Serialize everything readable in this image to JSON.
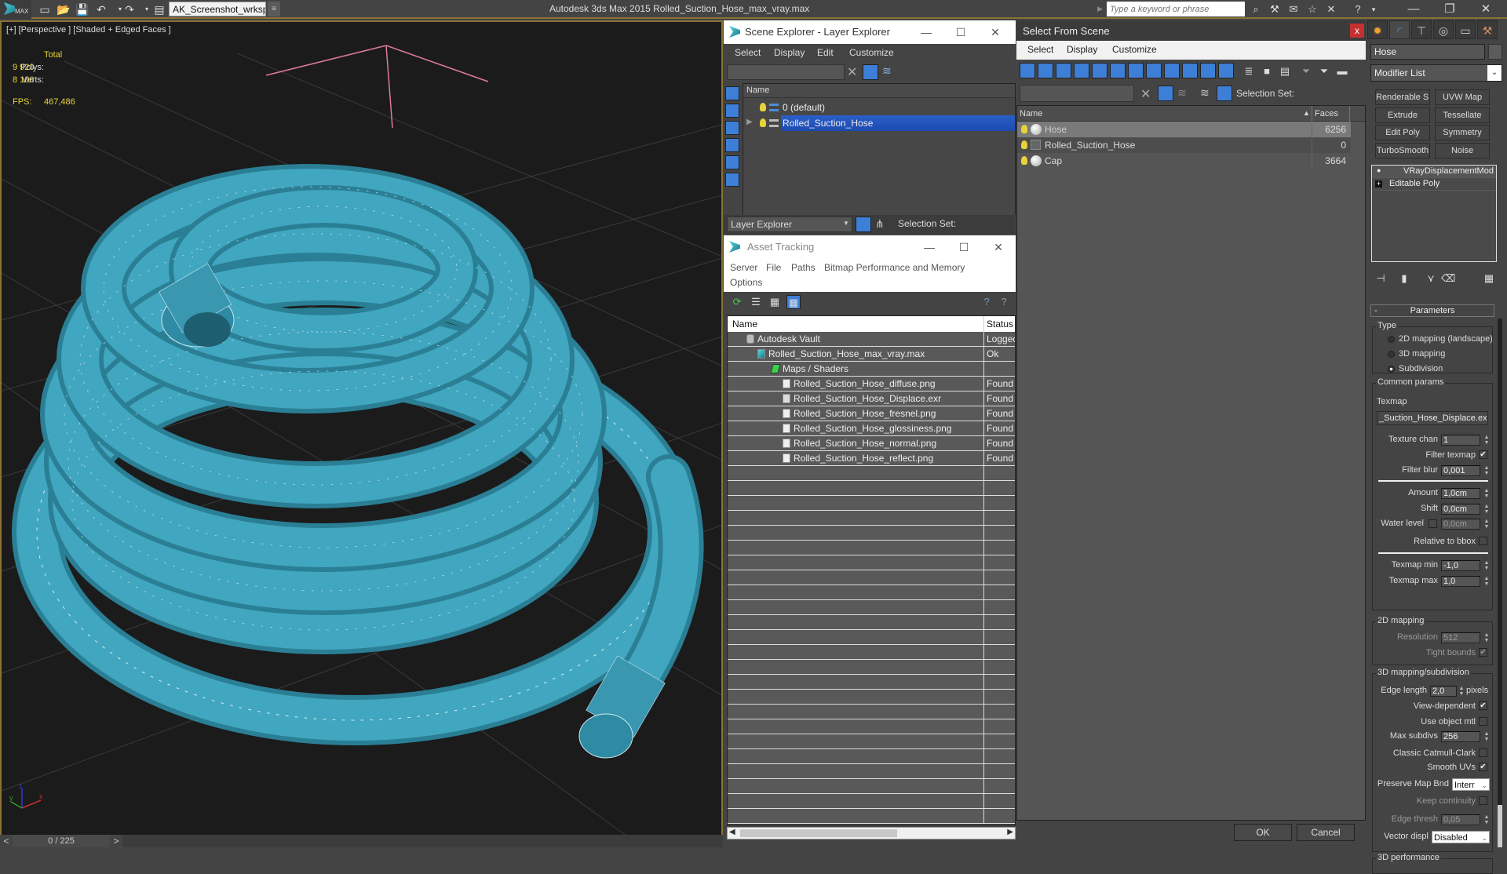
{
  "titlebar": {
    "logo_text": "MAX",
    "workspace": "AK_Screenshot_wrksp",
    "app_title": "Autodesk 3ds Max  2015     Rolled_Suction_Hose_max_vray.max",
    "search_placeholder": "Type a keyword or phrase"
  },
  "viewport": {
    "label": "[+] [Perspective ] [Shaded + Edged Faces ]",
    "stats_header": "Total",
    "polys_label": "Polys:",
    "polys_value": "9 920",
    "verts_label": "Verts:",
    "verts_value": "8 106",
    "fps_label": "FPS:",
    "fps_value": "467,486",
    "axis": {
      "x": "x",
      "y": "y",
      "z": "z"
    },
    "mesh_color": "#3c9fb8"
  },
  "timeline": {
    "prev": "<",
    "position": "0 / 225",
    "next": ">"
  },
  "scene_explorer": {
    "title": "Scene Explorer - Layer Explorer",
    "menu": [
      "Select",
      "Display",
      "Edit",
      "Customize"
    ],
    "column_name": "Name",
    "rows": [
      {
        "name": "0 (default)",
        "selected": false
      },
      {
        "name": "Rolled_Suction_Hose",
        "selected": true
      }
    ],
    "explorer_mode": "Layer Explorer",
    "selection_set_label": "Selection Set:"
  },
  "asset_tracking": {
    "title": "Asset Tracking",
    "menu": [
      "Server",
      "File",
      "Paths",
      "Bitmap Performance and Memory",
      "Options"
    ],
    "columns": [
      "Name",
      "Status"
    ],
    "rows": [
      {
        "name": "Autodesk Vault",
        "status": "Logged",
        "indent": 0,
        "icon": "vault-icon"
      },
      {
        "name": "Rolled_Suction_Hose_max_vray.max",
        "status": "Ok",
        "indent": 1,
        "icon": "max-file-icon"
      },
      {
        "name": "Maps / Shaders",
        "status": "",
        "indent": 2,
        "icon": "maps-icon"
      },
      {
        "name": "Rolled_Suction_Hose_diffuse.png",
        "status": "Found",
        "indent": 3,
        "icon": "image-file-icon"
      },
      {
        "name": "Rolled_Suction_Hose_Displace.exr",
        "status": "Found",
        "indent": 3,
        "icon": "exr-file-icon"
      },
      {
        "name": "Rolled_Suction_Hose_fresnel.png",
        "status": "Found",
        "indent": 3,
        "icon": "image-file-icon"
      },
      {
        "name": "Rolled_Suction_Hose_glossiness.png",
        "status": "Found",
        "indent": 3,
        "icon": "image-file-icon"
      },
      {
        "name": "Rolled_Suction_Hose_normal.png",
        "status": "Found",
        "indent": 3,
        "icon": "image-file-icon"
      },
      {
        "name": "Rolled_Suction_Hose_reflect.png",
        "status": "Found",
        "indent": 3,
        "icon": "image-file-icon"
      }
    ]
  },
  "select_from_scene": {
    "title": "Select From Scene",
    "close": "x",
    "menu": [
      "Select",
      "Display",
      "Customize"
    ],
    "selection_set_label": "Selection Set:",
    "columns": [
      "Name",
      "Faces"
    ],
    "rows": [
      {
        "name": "Hose",
        "faces": "6256",
        "selected": true,
        "icon": "geometry-icon"
      },
      {
        "name": "Rolled_Suction_Hose",
        "faces": "0",
        "selected": false,
        "icon": "group-icon"
      },
      {
        "name": "Cap",
        "faces": "3664",
        "selected": false,
        "icon": "geometry-icon"
      }
    ],
    "ok": "OK",
    "cancel": "Cancel"
  },
  "command_panel": {
    "object_name": "Hose",
    "modifier_list": "Modifier List",
    "modifier_buttons": [
      "Renderable Spline",
      "UVW Map",
      "Extrude",
      "Tessellate",
      "Edit Poly",
      "Symmetry",
      "TurboSmooth",
      "Noise"
    ],
    "stack": [
      "VRayDisplacementMod",
      "Editable Poly"
    ],
    "rollout_title": "Parameters",
    "rollout_collapse": "-",
    "type_group": "Type",
    "type_options": [
      {
        "label": "2D mapping (landscape)",
        "selected": false
      },
      {
        "label": "3D mapping",
        "selected": false
      },
      {
        "label": "Subdivision",
        "selected": true
      }
    ],
    "common_group": "Common params",
    "texmap_label": "Texmap",
    "texmap_value": "_Suction_Hose_Displace.exr)",
    "texture_chan_label": "Texture chan",
    "texture_chan": "1",
    "filter_texmap_label": "Filter texmap",
    "filter_texmap": true,
    "filter_blur_label": "Filter blur",
    "filter_blur": "0,001",
    "amount_label": "Amount",
    "amount": "1,0cm",
    "shift_label": "Shift",
    "shift": "0,0cm",
    "water_level_label": "Water level",
    "water_level_enabled": false,
    "water_level": "0,0cm",
    "relative_bbox_label": "Relative to bbox",
    "relative_bbox": false,
    "texmap_min_label": "Texmap min",
    "texmap_min": "-1,0",
    "texmap_max_label": "Texmap max",
    "texmap_max": "1,0",
    "mapping2d_group": "2D mapping",
    "resolution_label": "Resolution",
    "resolution": "512",
    "tight_bounds_label": "Tight bounds",
    "tight_bounds": true,
    "mapping3d_group": "3D mapping/subdivision",
    "edge_length_label": "Edge length",
    "edge_length": "2,0",
    "edge_length_unit": "pixels",
    "view_dependent_label": "View-dependent",
    "view_dependent": true,
    "use_object_mtl_label": "Use object mtl",
    "use_object_mtl": false,
    "max_subdivs_label": "Max subdivs",
    "max_subdivs": "256",
    "catmull_label": "Classic Catmull-Clark",
    "catmull": false,
    "smooth_uvs_label": "Smooth UVs",
    "smooth_uvs": true,
    "preserve_label": "Preserve Map Bnd",
    "preserve_value": "Interr",
    "keep_continuity_label": "Keep continuity",
    "keep_continuity": false,
    "edge_thresh_label": "Edge thresh",
    "edge_thresh": "0,05",
    "vector_displ_label": "Vector displ",
    "vector_displ": "Disabled",
    "perf_group": "3D performance"
  }
}
